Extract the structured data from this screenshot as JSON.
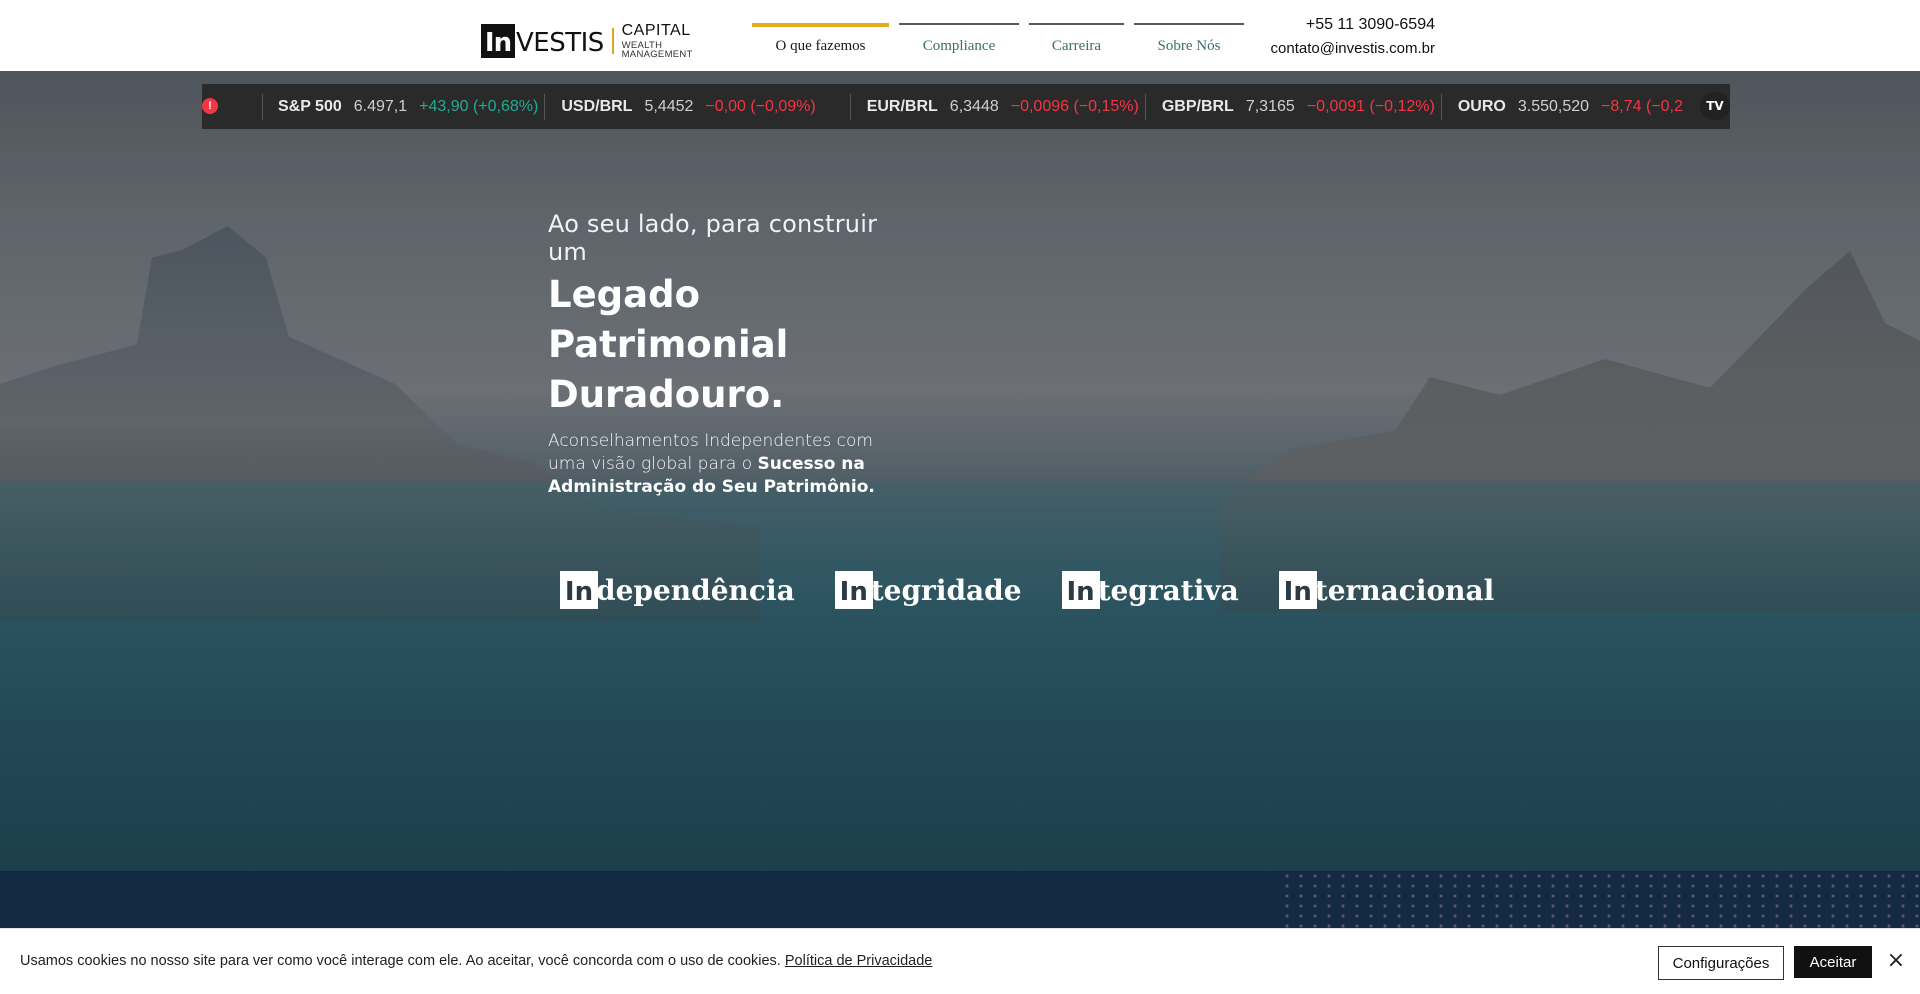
{
  "header": {
    "logo": {
      "in_mark": "In",
      "name_rest": "VESTIS",
      "capital": "CAPITAL",
      "wealth": "WEALTH MANAGEMENT"
    },
    "nav": [
      {
        "label": "O que fazemos",
        "active": true
      },
      {
        "label": "Compliance",
        "active": false
      },
      {
        "label": "Carreira",
        "active": false
      },
      {
        "label": "Sobre Nós",
        "active": false
      }
    ],
    "contact": {
      "phone": "+55 11 3090-6594",
      "email": "contato@investis.com.br"
    }
  },
  "ticker": {
    "alert_icon": "!",
    "brand_icon": "TV",
    "items": [
      {
        "symbol": "S&P 500",
        "price": "6.497,1",
        "change": "+43,90 (+0,68%)",
        "direction": "up"
      },
      {
        "symbol": "USD/BRL",
        "price": "5,4452",
        "change": "−0,00 (−0,09%)",
        "direction": "down"
      },
      {
        "symbol": "EUR/BRL",
        "price": "6,3448",
        "change": "−0,0096 (−0,15%)",
        "direction": "down"
      },
      {
        "symbol": "GBP/BRL",
        "price": "7,3165",
        "change": "−0,0091 (−0,12%)",
        "direction": "down"
      },
      {
        "symbol": "OURO",
        "price": "3.550,520",
        "change": "−8,74 (−0,2",
        "direction": "down"
      }
    ],
    "colors": {
      "up": "#22ab94",
      "down": "#f23645"
    }
  },
  "hero": {
    "kicker": "Ao seu lado, para construir um",
    "title_line1": "Legado Patrimonial",
    "title_line2": "Duradouro.",
    "desc_plain": "Aconselhamentos Independentes com uma visão global para o ",
    "desc_bold": "Sucesso na Administração do Seu Patrimônio."
  },
  "values": [
    {
      "box": "In",
      "word": "dependência"
    },
    {
      "box": "In",
      "word": "tegridade"
    },
    {
      "box": "In",
      "word": "tegrativa"
    },
    {
      "box": "In",
      "word": "ternacional"
    }
  ],
  "cookie": {
    "message": "Usamos cookies no nosso site para ver como você interage com ele. Ao aceitar, você concorda com o uso de cookies.",
    "policy_link": "Política de Privacidade",
    "settings_button": "Configurações",
    "accept_button": "Aceitar",
    "close_icon": "×"
  },
  "colors": {
    "accent": "#e3ab1e",
    "nav_text": "#3c6e6c",
    "band": "#142a44"
  }
}
